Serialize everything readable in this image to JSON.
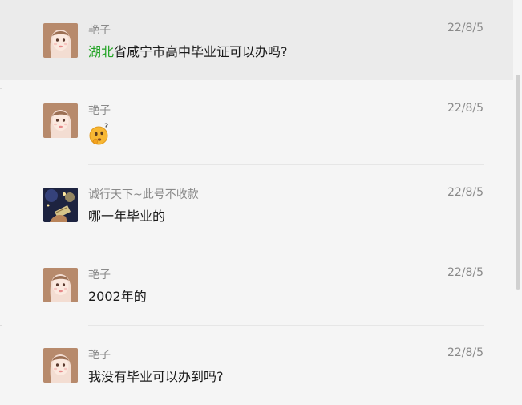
{
  "messages": [
    {
      "sender": "艳子",
      "time": "22/8/5",
      "link": "湖北",
      "text": "省咸宁市高中毕业证可以办吗?"
    },
    {
      "sender": "艳子",
      "time": "22/8/5",
      "emoji": "thinking-face-emoji"
    },
    {
      "sender": "诚行天下~此号不收款",
      "time": "22/8/5",
      "text": "哪一年毕业的"
    },
    {
      "sender": "艳子",
      "time": "22/8/5",
      "text": "2002年的"
    },
    {
      "sender": "艳子",
      "time": "22/8/5",
      "text": "我没有毕业可以办到吗?"
    }
  ],
  "colors": {
    "link": "#22a324",
    "hover_bg": "#ebebeb",
    "bg": "#f5f5f5"
  }
}
